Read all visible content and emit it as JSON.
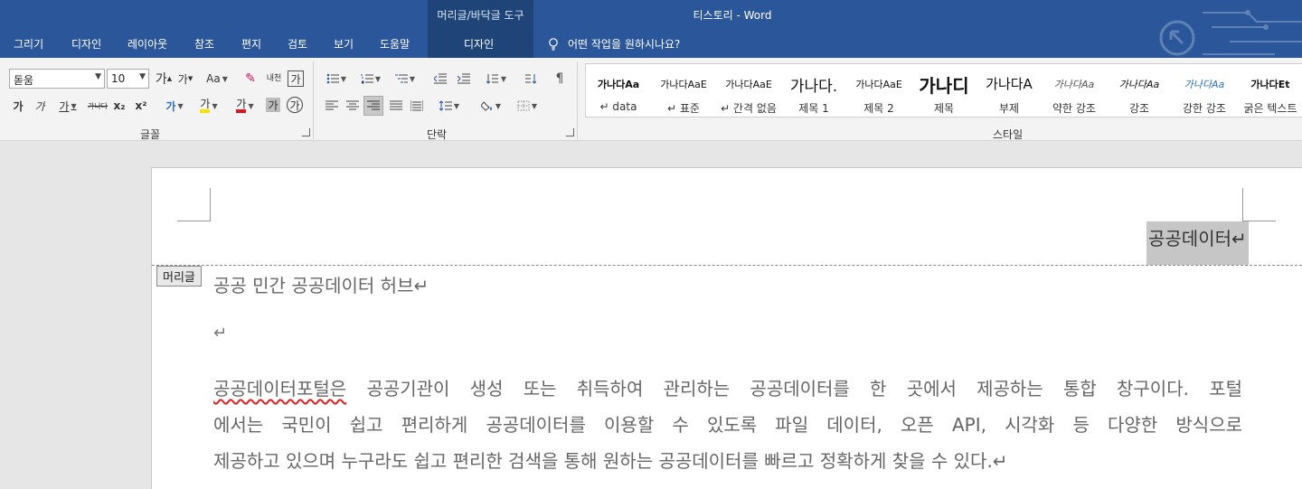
{
  "title_bar": {
    "contextual_tab_group": "머리글/바닥글 도구",
    "window_title": "티스토리  -  Word"
  },
  "tabs": [
    {
      "label": "그리기"
    },
    {
      "label": "디자인"
    },
    {
      "label": "레이아웃"
    },
    {
      "label": "참조"
    },
    {
      "label": "편지"
    },
    {
      "label": "검토"
    },
    {
      "label": "보기"
    },
    {
      "label": "도움말"
    },
    {
      "label": "디자인"
    }
  ],
  "tell_me": {
    "placeholder": "어떤 작업을 원하시나요?",
    "icon": "lightbulb-icon"
  },
  "ribbon": {
    "font_group": {
      "label": "글꼴",
      "font_name": "돋움",
      "font_size": "10",
      "grow_font": "가",
      "shrink_font": "가",
      "change_case": "Aa",
      "phonetic_guide": "내천",
      "char_border": "가",
      "bold": "가",
      "italic": "가",
      "underline": "가",
      "strikethrough": "가나다",
      "subscript": "x₂",
      "superscript": "x²",
      "text_effects": "가",
      "highlight": "가",
      "font_color": "가",
      "char_shading": "가",
      "enclose_char": "가"
    },
    "paragraph_group": {
      "label": "단락"
    },
    "styles_group": {
      "label": "스타일",
      "items": [
        {
          "preview": "가나다Aa",
          "name": "↵ data"
        },
        {
          "preview": "가나다AaE",
          "name": "↵ 표준"
        },
        {
          "preview": "가나다AaE",
          "name": "↵ 간격 없음"
        },
        {
          "preview": "가나다.",
          "name": "제목 1"
        },
        {
          "preview": "가나다AaE",
          "name": "제목 2"
        },
        {
          "preview": "가나디",
          "name": "제목"
        },
        {
          "preview": "가나다A",
          "name": "부제"
        },
        {
          "preview": "가나다Aa",
          "name": "약한 강조"
        },
        {
          "preview": "가나다Aa",
          "name": "강조"
        },
        {
          "preview": "가나다Aa",
          "name": "강한 강조"
        },
        {
          "preview": "가나다Et",
          "name": "굵은 텍스트"
        }
      ]
    }
  },
  "document": {
    "header_text": "공공데이터↵",
    "header_tag": "머리글",
    "heading_line": "공공 민간 공공데이터 허브↵",
    "empty_paragraph": "↵",
    "body_first_word": "공공데이터포털은",
    "body_line1_rest": " 공공기관이 생성 또는 취득하여 관리하는 공공데이터를 한 곳에서 제공하는 통합 창구이다. 포털",
    "body_line2": "에서는 국민이 쉽고 편리하게 공공데이터를 이용할 수 있도록 파일 데이터, 오픈 API, 시각화 등 다양한 방식으로",
    "body_line3": "제공하고 있으며 누구라도 쉽고 편리한 검색을 통해 원하는 공공데이터를 빠르고 정확하게 찾을 수 있다.↵"
  },
  "colors": {
    "accent": "#2b579a",
    "ribbon_bg": "#f3f3f3",
    "doc_bg": "#e6e6e6"
  }
}
